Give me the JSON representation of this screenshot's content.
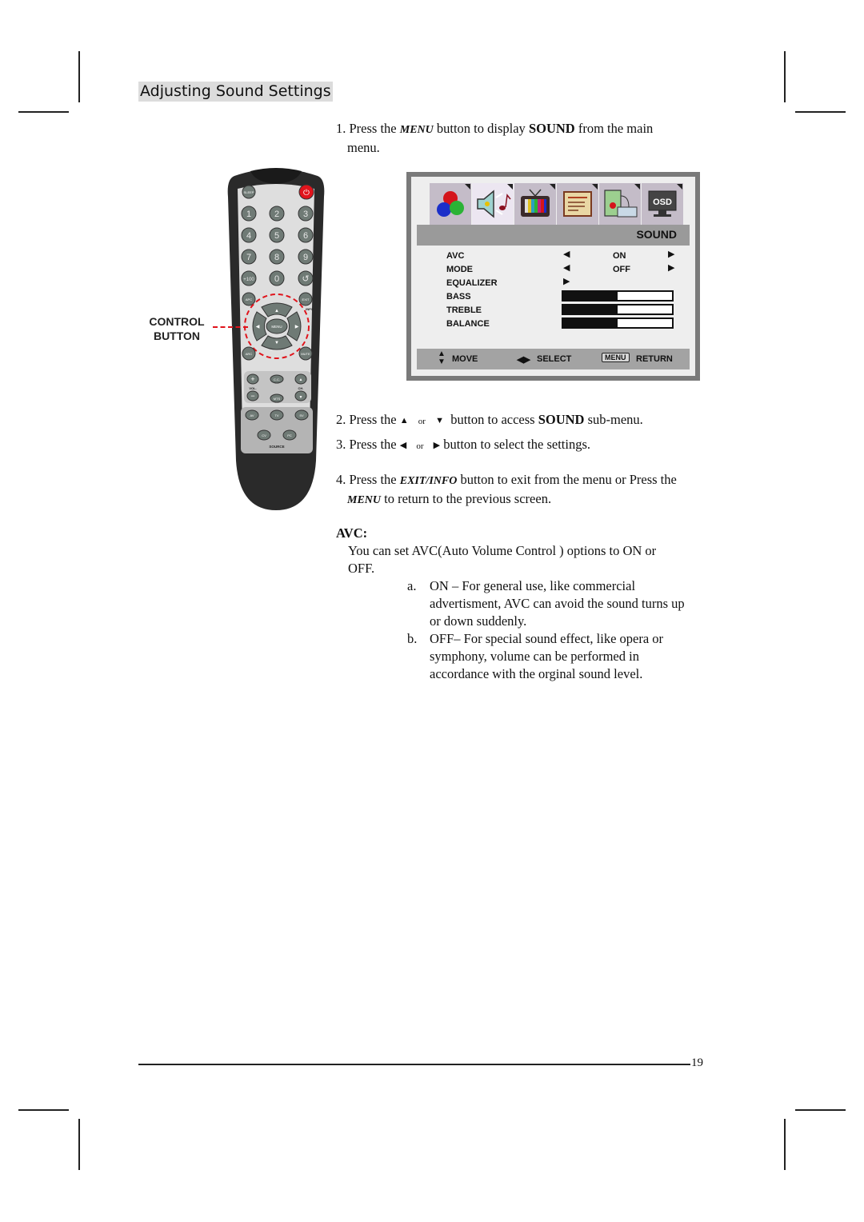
{
  "page": {
    "section_title": "Adjusting Sound Settings",
    "page_number": "19"
  },
  "steps": {
    "s1": {
      "num": "1.",
      "pre": "Press the",
      "key": "MENU",
      "mid": "button to display",
      "bold": "SOUND",
      "post": "from the main",
      "cont": "menu."
    },
    "s2": {
      "num": "2.",
      "pre": "Press the",
      "up": "▲",
      "or": "or",
      "down": "▼",
      "mid": "button to access",
      "bold": "SOUND",
      "post": "sub-menu."
    },
    "s3": {
      "num": "3.",
      "pre": "Press the",
      "left": "◀",
      "or": "or",
      "right": "▶",
      "post": "button to select the settings."
    },
    "s4": {
      "num": "4.",
      "pre": "Press the",
      "key": "EXIT/INFO",
      "post": "button to exit from the menu or Press the",
      "key2": "MENU",
      "post2": "to return to the previous screen."
    }
  },
  "avc": {
    "heading": "AVC:",
    "intro_1": "You can set AVC(Auto Volume Control ) options to ON or",
    "intro_2": "OFF.",
    "items": [
      {
        "marker": "a.",
        "lines": [
          "ON – For general use, like commercial",
          "advertisment, AVC can avoid the sound turns up",
          "or down suddenly."
        ]
      },
      {
        "marker": "b.",
        "lines": [
          "OFF– For special sound effect, like opera or",
          "symphony, volume can be performed in",
          "accordance with the orginal sound level."
        ]
      }
    ]
  },
  "osd": {
    "tabs": [
      "picture-icon",
      "sound-icon",
      "tv-icon",
      "setup-icon",
      "pc-icon",
      "osd-icon"
    ],
    "osd_tab_text": "OSD",
    "selected_tab": "sound-icon",
    "header": "SOUND",
    "rows": [
      {
        "label": "AVC",
        "value": "ON",
        "type": "option"
      },
      {
        "label": "MODE",
        "value": "OFF",
        "type": "option"
      },
      {
        "label": "EQUALIZER",
        "type": "submenu"
      },
      {
        "label": "BASS",
        "type": "bar",
        "level": 0.5
      },
      {
        "label": "TREBLE",
        "type": "bar",
        "level": 0.5
      },
      {
        "label": "BALANCE",
        "type": "bar",
        "level": 0.5
      }
    ],
    "footer": {
      "move": "MOVE",
      "select": "SELECT",
      "menu_key": "MENU",
      "return": "RETURN"
    }
  },
  "remote": {
    "callout": [
      "CONTROL",
      "BUTTON"
    ],
    "buttons": {
      "sleep": "SLEEP",
      "power": "⏻",
      "digits": [
        "1",
        "2",
        "3",
        "4",
        "5",
        "6",
        "7",
        "8",
        "9"
      ],
      "plus100": "+100",
      "zero": "0",
      "recall": "↺",
      "apc": "APC",
      "exit": "EXIT",
      "info": "INFO",
      "menu": "MENU",
      "up": "▲",
      "down": "▼",
      "left": "◀",
      "right": "▶",
      "arc": "ARC",
      "mute": "MUTE",
      "vol_plus": "+",
      "vol_minus": "−",
      "vol": "VOL.",
      "cc": "C.C.",
      "mts": "MTS",
      "ch_up": "▲",
      "ch_down": "▼",
      "ch": "CH.",
      "av": "AV",
      "tv": "TV",
      "sv": "SV",
      "cv": "CV",
      "pc": "PC",
      "source": "SOURCE"
    }
  },
  "colors": {
    "power_red": "#e0141c",
    "callout_red": "#e0141c",
    "remote_body": "#2a2a2a",
    "remote_face": "#dcdcdc",
    "button_gray": "#6f7a75"
  }
}
